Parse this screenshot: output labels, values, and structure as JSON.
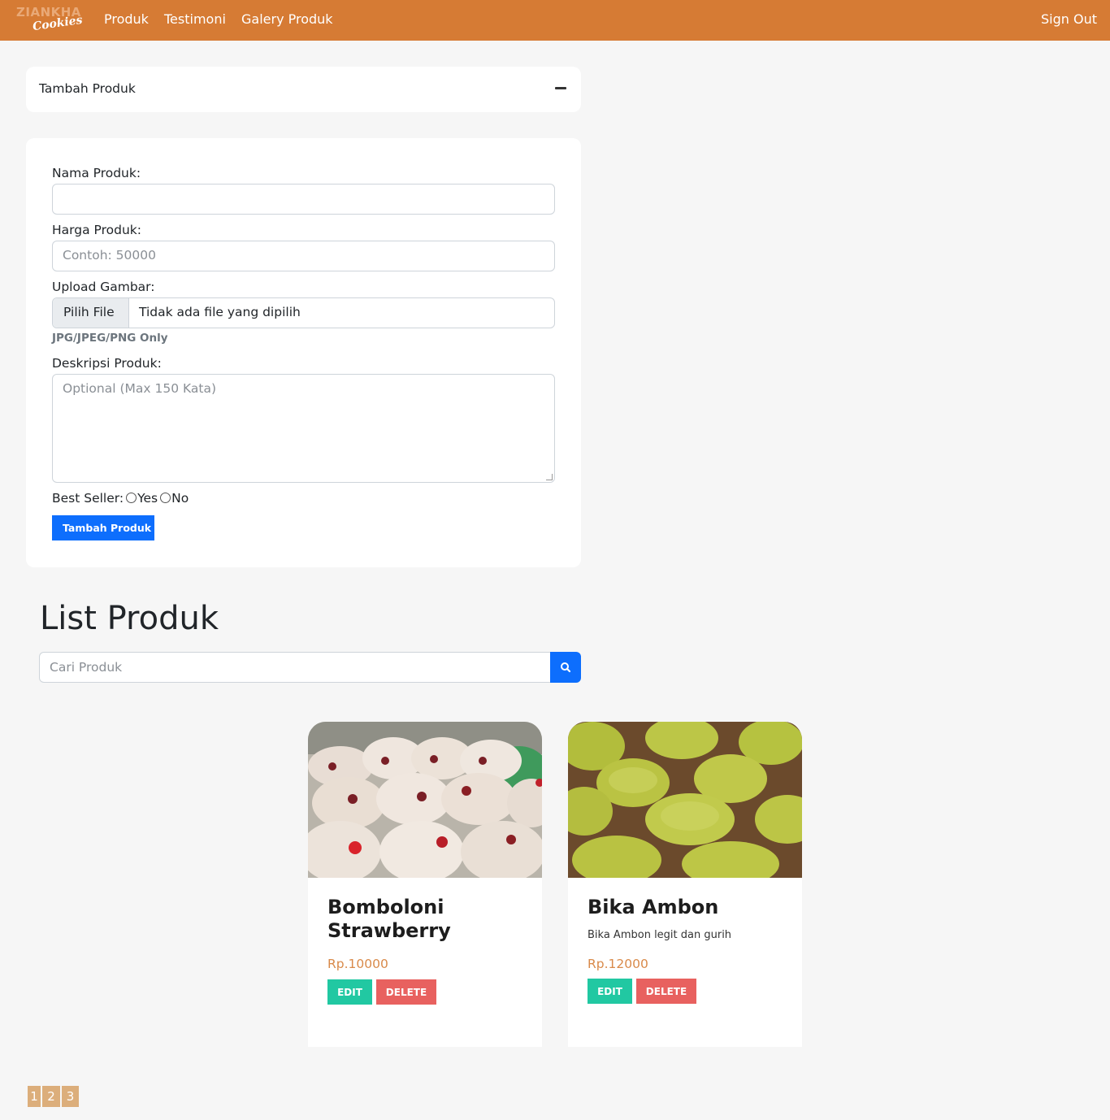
{
  "brand": {
    "line1": "ZIANKHA",
    "line2": "Cookies"
  },
  "nav": {
    "produk": "Produk",
    "testimoni": "Testimoni",
    "galery": "Galery Produk",
    "signout": "Sign Out"
  },
  "collapse": {
    "title": "Tambah Produk"
  },
  "form": {
    "nama_label": "Nama Produk:",
    "nama_value": "",
    "harga_label": "Harga Produk:",
    "harga_placeholder": "Contoh: 50000",
    "upload_label": "Upload Gambar:",
    "file_button": "Pilih File",
    "file_status": "Tidak ada file yang dipilih",
    "file_hint": "JPG/JPEG/PNG Only",
    "deskripsi_label": "Deskripsi Produk:",
    "deskripsi_placeholder": "Optional (Max 150 Kata)",
    "best_seller_label": "Best Seller:",
    "yes": "Yes",
    "no": "No",
    "submit": "Tambah Produk"
  },
  "list": {
    "title": "List Produk",
    "search_placeholder": "Cari Produk"
  },
  "products": [
    {
      "name": "Bomboloni Strawberry",
      "description": "",
      "price": "Rp.10000",
      "edit": "EDIT",
      "delete": "DELETE"
    },
    {
      "name": "Bika Ambon",
      "description": "Bika Ambon legit dan gurih",
      "price": "Rp.12000",
      "edit": "EDIT",
      "delete": "DELETE"
    }
  ],
  "pagination": [
    "1",
    "2",
    "3"
  ],
  "colors": {
    "navbar": "#d67b34",
    "primary": "#0d6efd",
    "edit": "#21c8a2",
    "delete": "#e8615f",
    "price": "#d98a4a",
    "pager": "#dcae7b"
  }
}
